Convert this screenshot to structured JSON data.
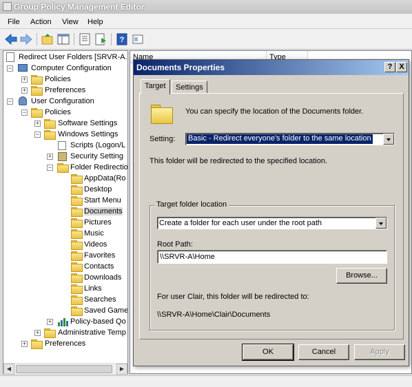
{
  "window": {
    "title": "Group Policy Management Editor"
  },
  "menu": [
    "File",
    "Action",
    "View",
    "Help"
  ],
  "toolbar": {
    "buttons": [
      "back-arrow-icon",
      "forward-arrow-icon",
      "up-folder-icon",
      "show-hide-tree-icon",
      "properties-icon",
      "export-list-icon",
      "help-icon",
      "view-icon"
    ]
  },
  "tree": {
    "root": "Redirect User Folders [SRVR-A.I",
    "items": [
      "Computer Configuration",
      "Policies",
      "Preferences",
      "User Configuration",
      "Policies",
      "Software Settings",
      "Windows Settings",
      "Scripts (Logon/L",
      "Security Setting",
      "Folder Redirectio",
      "AppData(Ro",
      "Desktop",
      "Start Menu",
      "Documents",
      "Pictures",
      "Music",
      "Videos",
      "Favorites",
      "Contacts",
      "Downloads",
      "Links",
      "Searches",
      "Saved Game",
      "Policy-based Qo",
      "Administrative Temp",
      "Preferences"
    ]
  },
  "list": {
    "columns": [
      "Name",
      "Type"
    ]
  },
  "dialog": {
    "title": "Documents Properties",
    "title_buttons": [
      "?",
      "X"
    ],
    "tabs": [
      "Target",
      "Settings"
    ],
    "intro": "You can specify the location of the Documents folder.",
    "setting_label": "Setting:",
    "setting_value": "Basic - Redirect everyone's folder to the same location",
    "description": "This folder will be redirected to the specified location.",
    "target_group_label": "Target folder location",
    "target_value": "Create a folder for each user under the root path",
    "root_path_label": "Root Path:",
    "root_path_value": "\\\\SRVR-A\\Home",
    "browse_label": "Browse...",
    "redirect_note": "For user Clair, this folder will be redirected to:",
    "redirect_path": "\\\\SRVR-A\\Home\\Clair\\Documents",
    "ok_label": "OK",
    "cancel_label": "Cancel",
    "apply_label": "Apply"
  }
}
